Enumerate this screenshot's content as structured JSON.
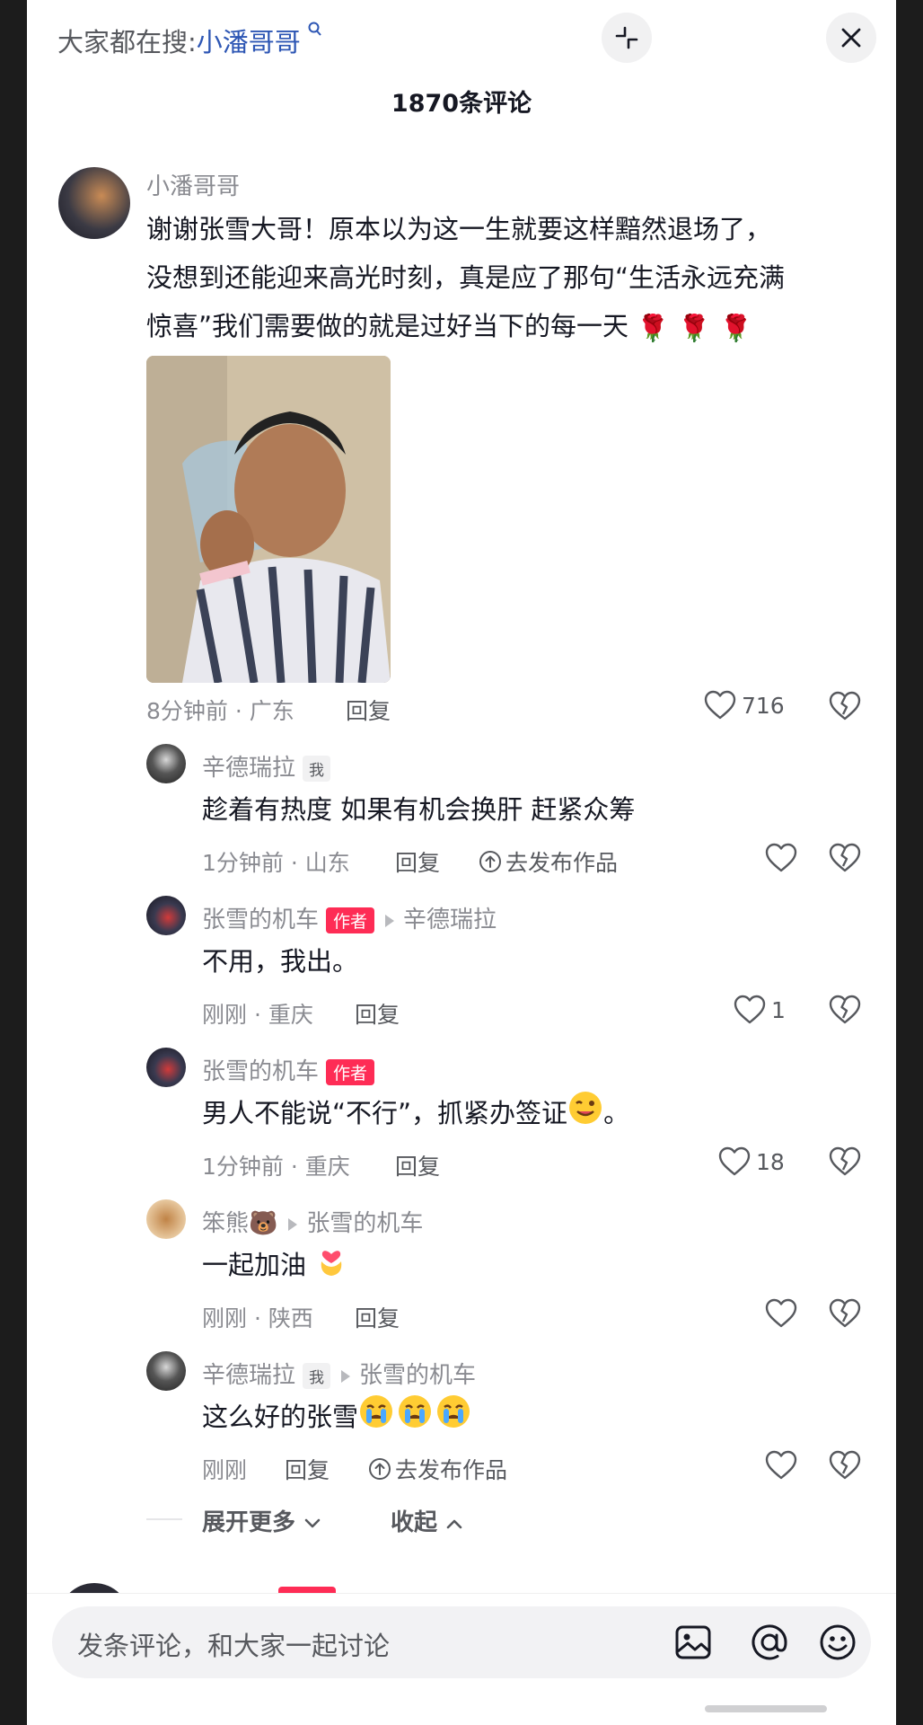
{
  "header": {
    "search_hint_prefix": "大家都在搜:",
    "search_term": "小潘哥哥",
    "comment_count": "1870条评论"
  },
  "comments": [
    {
      "username": "小潘哥哥",
      "text_lines": [
        "谢谢张雪大哥！原本以为这一生就要这样黯然退场了，",
        "没想到还能迎来高光时刻，真是应了那句“生活永远充满",
        "惊喜”我们需要做的就是过好当下的每一天"
      ],
      "emojis": "🌹🌹🌹",
      "meta": "8分钟前 · 广东",
      "reply_label": "回复",
      "likes": "716"
    }
  ],
  "replies": [
    {
      "username": "辛德瑞拉",
      "badge": "我",
      "text": "趁着有热度 如果有机会换肝 赶紧众筹",
      "meta": "1分钟前 · 山东",
      "reply_label": "回复",
      "publish_label": "去发布作品",
      "likes": ""
    },
    {
      "username": "张雪的机车",
      "badge": "作者",
      "reply_to": "辛德瑞拉",
      "text": "不用，我出。",
      "meta": "刚刚 · 重庆",
      "reply_label": "回复",
      "likes": "1"
    },
    {
      "username": "张雪的机车",
      "badge": "作者",
      "text": "男人不能说“不行”，抓紧办签证",
      "text_suffix": "。",
      "meta": "1分钟前 · 重庆",
      "reply_label": "回复",
      "likes": "18"
    },
    {
      "username": "笨熊",
      "username_emoji": "🐻",
      "reply_to": "张雪的机车",
      "text": "一起加油",
      "meta": "刚刚 · 陕西",
      "reply_label": "回复",
      "likes": ""
    },
    {
      "username": "辛德瑞拉",
      "badge": "我",
      "reply_to": "张雪的机车",
      "text": "这么好的张雪",
      "meta": "刚刚",
      "reply_label": "回复",
      "publish_label": "去发布作品",
      "likes": ""
    }
  ],
  "expand": {
    "more_label": "展开更多",
    "collapse_label": "收起"
  },
  "input": {
    "placeholder": "发条评论，和大家一起讨论"
  },
  "colors": {
    "accent": "#fe2c55",
    "link": "#2d56b4",
    "muted": "#8a8b91"
  }
}
